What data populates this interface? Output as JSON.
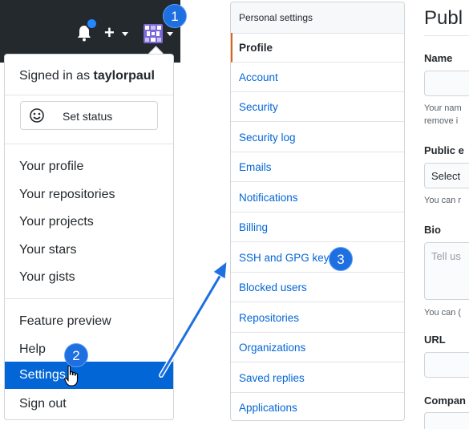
{
  "dropdown": {
    "signed_in_prefix": "Signed in as",
    "username": "taylorpaul",
    "set_status": "Set status",
    "items": [
      "Your profile",
      "Your repositories",
      "Your projects",
      "Your stars",
      "Your gists"
    ],
    "feature_preview": "Feature preview",
    "help": "Help",
    "settings": "Settings",
    "sign_out": "Sign out"
  },
  "header": {
    "plus": "+"
  },
  "badges": {
    "one": "1",
    "two": "2",
    "three": "3"
  },
  "settings_nav": {
    "heading": "Personal settings",
    "items": [
      "Profile",
      "Account",
      "Security",
      "Security log",
      "Emails",
      "Notifications",
      "Billing",
      "SSH and GPG keys",
      "Blocked users",
      "Repositories",
      "Organizations",
      "Saved replies",
      "Applications"
    ],
    "active": "Profile"
  },
  "profile_form": {
    "title": "Publ",
    "name_label": "Name",
    "name_note_1": "Your nam",
    "name_note_2": "remove i",
    "public_email_label": "Public e",
    "public_email_value": "Select",
    "public_email_note": "You can r",
    "bio_label": "Bio",
    "bio_placeholder": "Tell us",
    "bio_note": "You can (",
    "url_label": "URL",
    "company_label": "Compan"
  },
  "colors": {
    "header_bg": "#24292e",
    "link": "#0366d6",
    "active_border": "#e36209",
    "badge": "#1e6fe0"
  }
}
